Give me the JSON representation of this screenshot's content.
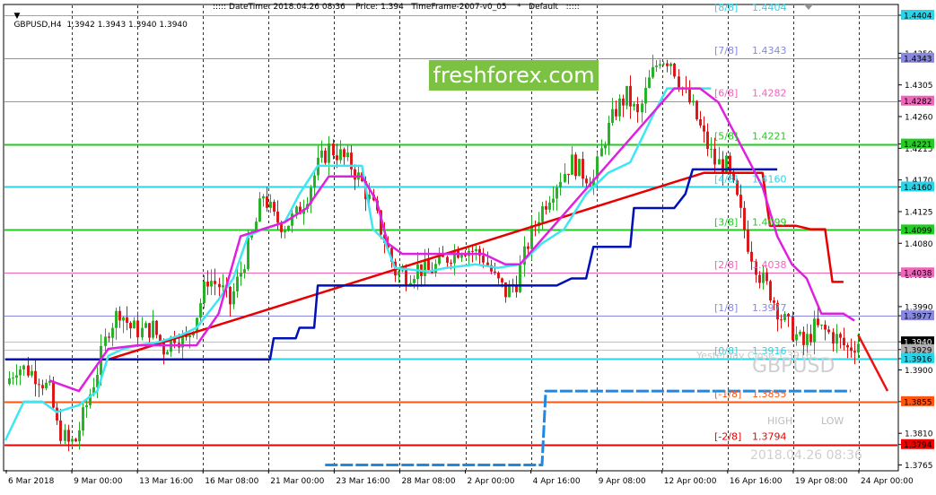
{
  "header": {
    "symbol_text": "GBPUSD,H4  1.3942 1.3943 1.3940 1.3940",
    "info_text": "::::: DateTime: 2018.04.26 08:36    Price: 1.394   TimeFrame-2007-v0_05    *   Default   :::::"
  },
  "brand": {
    "logo_text": "freshforex.com"
  },
  "watermark": {
    "symbol": "GBPUSD",
    "yesterday_text": "Yesterday Close 1.3916",
    "high_label": "HIGH",
    "low_label": "LOW",
    "datetime": "2018.04.26 08:36"
  },
  "colors": {
    "bull": "#22b022",
    "bear": "#dd1111",
    "cyan_line": "#3ee6f2",
    "magenta_line": "#e020e0",
    "blue_step": "#0010b8",
    "red_step": "#e80000",
    "dash_blue": "#1e88e5",
    "grid": "#000000"
  },
  "chart_data": {
    "type": "candlestick",
    "symbol": "GBPUSD",
    "timeframe": "H4",
    "ylim": [
      1.3758,
      1.4418
    ],
    "ohlc": [
      1.3942,
      1.3943,
      1.394,
      1.394
    ],
    "y_ticks": [
      "1.4404",
      "1.4350",
      "1.4343",
      "1.4305",
      "1.4282",
      "1.4260",
      "1.4221",
      "1.4215",
      "1.4170",
      "1.4160",
      "1.4125",
      "1.4099",
      "1.4080",
      "1.4038",
      "1.4035",
      "1.3990",
      "1.3977",
      "1.3940",
      "1.3929",
      "1.3916",
      "1.3900",
      "1.3855",
      "1.3810",
      "1.3794",
      "1.3765"
    ],
    "x_ticks": [
      "6 Mar 2018",
      "9 Mar 00:00",
      "13 Mar 16:00",
      "16 Mar 08:00",
      "21 Mar 00:00",
      "23 Mar 16:00",
      "28 Mar 08:00",
      "2 Apr 00:00",
      "4 Apr 16:00",
      "9 Apr 08:00",
      "12 Apr 00:00",
      "16 Apr 16:00",
      "19 Apr 08:00",
      "24 Apr 00:00"
    ],
    "price_tags": [
      {
        "label": "1.4404",
        "value": 1.4404,
        "color": "#2ad4e8"
      },
      {
        "label": "1.4343",
        "value": 1.4343,
        "color": "#8888e0"
      },
      {
        "label": "1.4282",
        "value": 1.4282,
        "color": "#ee66bb"
      },
      {
        "label": "1.4221",
        "value": 1.4221,
        "color": "#22cc22"
      },
      {
        "label": "1.4160",
        "value": 1.416,
        "color": "#2ad4e8"
      },
      {
        "label": "1.4099",
        "value": 1.4099,
        "color": "#22cc22"
      },
      {
        "label": "1.4038",
        "value": 1.4038,
        "color": "#ee66bb"
      },
      {
        "label": "1.3977",
        "value": 1.3977,
        "color": "#8888e0"
      },
      {
        "label": "1.3940",
        "value": 1.394,
        "color": "#000000"
      },
      {
        "label": "1.3929",
        "value": 1.3929,
        "color": "#b0b0b0"
      },
      {
        "label": "1.3916",
        "value": 1.3916,
        "color": "#2ad4e8"
      },
      {
        "label": "1.3855",
        "value": 1.3855,
        "color": "#ff5511"
      },
      {
        "label": "1.3794",
        "value": 1.3794,
        "color": "#ee0000"
      }
    ],
    "murrey_levels": [
      {
        "name": "[8/8]",
        "value": 1.4404,
        "value_label": "1.4404",
        "color": "#2ad4e8",
        "width": 1
      },
      {
        "name": "[7/8]",
        "value": 1.4343,
        "value_label": "1.4343",
        "color": "#8888e0",
        "width": 1
      },
      {
        "name": "[6/8]",
        "value": 1.4282,
        "value_label": "1.4282",
        "color": "#ee66bb",
        "width": 1
      },
      {
        "name": "[5/8]",
        "value": 1.4221,
        "value_label": "1.4221",
        "color": "#22cc22",
        "width": 2
      },
      {
        "name": "[4/8]",
        "value": 1.416,
        "value_label": "1.4160",
        "color": "#2ad4e8",
        "width": 2
      },
      {
        "name": "[3/8]",
        "value": 1.4099,
        "value_label": "1.4099",
        "color": "#22cc22",
        "width": 2
      },
      {
        "name": "[2/8]",
        "value": 1.4038,
        "value_label": "1.4038",
        "color": "#ee66bb",
        "width": 1
      },
      {
        "name": "[1/8]",
        "value": 1.3977,
        "value_label": "1.3977",
        "color": "#8888e0",
        "width": 1
      },
      {
        "name": "[0/8]",
        "value": 1.3916,
        "value_label": "1.3916",
        "color": "#2ad4e8",
        "width": 2
      },
      {
        "name": "[-1/8]",
        "value": 1.3855,
        "value_label": "1.3855",
        "color": "#ff5511",
        "width": 2
      },
      {
        "name": "[-2/8]",
        "value": 1.3794,
        "value_label": "1.3794",
        "color": "#ee0000",
        "width": 2
      }
    ],
    "price_path": [
      [
        0,
        1.388
      ],
      [
        3,
        1.3905
      ],
      [
        6,
        1.39
      ],
      [
        9,
        1.389
      ],
      [
        12,
        1.387
      ],
      [
        14,
        1.382
      ],
      [
        17,
        1.3795
      ],
      [
        19,
        1.38
      ],
      [
        22,
        1.385
      ],
      [
        25,
        1.39
      ],
      [
        28,
        1.396
      ],
      [
        31,
        1.3985
      ],
      [
        34,
        1.396
      ],
      [
        37,
        1.3955
      ],
      [
        40,
        1.396
      ],
      [
        43,
        1.393
      ],
      [
        46,
        1.395
      ],
      [
        49,
        1.394
      ],
      [
        52,
        1.398
      ],
      [
        55,
        1.403
      ],
      [
        58,
        1.402
      ],
      [
        61,
        1.3995
      ],
      [
        64,
        1.404
      ],
      [
        67,
        1.409
      ],
      [
        70,
        1.415
      ],
      [
        73,
        1.4115
      ],
      [
        76,
        1.4105
      ],
      [
        79,
        1.412
      ],
      [
        82,
        1.415
      ],
      [
        85,
        1.419
      ],
      [
        88,
        1.4215
      ],
      [
        91,
        1.4205
      ],
      [
        94,
        1.419
      ],
      [
        97,
        1.4165
      ],
      [
        100,
        1.413
      ],
      [
        103,
        1.4085
      ],
      [
        106,
        1.404
      ],
      [
        109,
        1.4035
      ],
      [
        112,
        1.4045
      ],
      [
        115,
        1.404
      ],
      [
        118,
        1.405
      ],
      [
        121,
        1.4065
      ],
      [
        124,
        1.4075
      ],
      [
        127,
        1.407
      ],
      [
        130,
        1.406
      ],
      [
        133,
        1.403
      ],
      [
        136,
        1.401
      ],
      [
        139,
        1.4025
      ],
      [
        142,
        1.408
      ],
      [
        145,
        1.412
      ],
      [
        148,
        1.415
      ],
      [
        151,
        1.4175
      ],
      [
        154,
        1.4195
      ],
      [
        157,
        1.418
      ],
      [
        160,
        1.417
      ],
      [
        163,
        1.423
      ],
      [
        166,
        1.427
      ],
      [
        169,
        1.429
      ],
      [
        172,
        1.426
      ],
      [
        175,
        1.431
      ],
      [
        178,
        1.4345
      ],
      [
        181,
        1.434
      ],
      [
        184,
        1.43
      ],
      [
        187,
        1.427
      ],
      [
        190,
        1.423
      ],
      [
        193,
        1.4195
      ],
      [
        196,
        1.419
      ],
      [
        199,
        1.414
      ],
      [
        202,
        1.408
      ],
      [
        205,
        1.4035
      ],
      [
        208,
        1.401
      ],
      [
        211,
        1.3975
      ],
      [
        214,
        1.3955
      ],
      [
        217,
        1.3935
      ],
      [
        220,
        1.396
      ],
      [
        223,
        1.3955
      ],
      [
        226,
        1.3945
      ],
      [
        229,
        1.393
      ],
      [
        232,
        1.394
      ]
    ],
    "cyan_line": [
      [
        0,
        1.38
      ],
      [
        5,
        1.3855
      ],
      [
        10,
        1.3855
      ],
      [
        14,
        1.384
      ],
      [
        20,
        1.385
      ],
      [
        25,
        1.387
      ],
      [
        28,
        1.392
      ],
      [
        32,
        1.393
      ],
      [
        36,
        1.3935
      ],
      [
        42,
        1.394
      ],
      [
        48,
        1.395
      ],
      [
        52,
        1.396
      ],
      [
        58,
        1.4
      ],
      [
        62,
        1.403
      ],
      [
        66,
        1.409
      ],
      [
        70,
        1.41
      ],
      [
        76,
        1.411
      ],
      [
        80,
        1.415
      ],
      [
        85,
        1.419
      ],
      [
        97,
        1.419
      ],
      [
        100,
        1.41
      ],
      [
        103,
        1.4085
      ],
      [
        106,
        1.4045
      ],
      [
        115,
        1.404
      ],
      [
        120,
        1.4045
      ],
      [
        128,
        1.405
      ],
      [
        134,
        1.4045
      ],
      [
        140,
        1.405
      ],
      [
        146,
        1.408
      ],
      [
        152,
        1.41
      ],
      [
        158,
        1.415
      ],
      [
        164,
        1.418
      ],
      [
        170,
        1.4195
      ],
      [
        176,
        1.426
      ],
      [
        180,
        1.43
      ],
      [
        192,
        1.43
      ]
    ],
    "magenta_line": [
      [
        12,
        1.3885
      ],
      [
        20,
        1.387
      ],
      [
        28,
        1.393
      ],
      [
        36,
        1.3935
      ],
      [
        44,
        1.3935
      ],
      [
        52,
        1.3935
      ],
      [
        58,
        1.398
      ],
      [
        64,
        1.409
      ],
      [
        70,
        1.41
      ],
      [
        76,
        1.411
      ],
      [
        82,
        1.413
      ],
      [
        88,
        1.4175
      ],
      [
        97,
        1.4175
      ],
      [
        101,
        1.414
      ],
      [
        104,
        1.408
      ],
      [
        108,
        1.4065
      ],
      [
        114,
        1.4065
      ],
      [
        120,
        1.4065
      ],
      [
        130,
        1.4065
      ],
      [
        136,
        1.405
      ],
      [
        140,
        1.405
      ],
      [
        182,
        1.43
      ],
      [
        189,
        1.43
      ],
      [
        194,
        1.428
      ],
      [
        198,
        1.424
      ],
      [
        202,
        1.42
      ],
      [
        206,
        1.416
      ],
      [
        210,
        1.409
      ],
      [
        214,
        1.405
      ],
      [
        218,
        1.403
      ],
      [
        222,
        1.398
      ],
      [
        228,
        1.398
      ],
      [
        231,
        1.397
      ]
    ],
    "blue_step": [
      [
        0,
        1.3915
      ],
      [
        72,
        1.3915
      ],
      [
        73,
        1.3945
      ],
      [
        79,
        1.3945
      ],
      [
        80,
        1.396
      ],
      [
        84,
        1.396
      ],
      [
        85,
        1.402
      ],
      [
        150,
        1.402
      ],
      [
        154,
        1.403
      ],
      [
        158,
        1.403
      ],
      [
        160,
        1.4075
      ],
      [
        170,
        1.4075
      ],
      [
        171,
        1.413
      ],
      [
        182,
        1.413
      ],
      [
        185,
        1.415
      ],
      [
        187,
        1.4185
      ],
      [
        210,
        1.4185
      ]
    ],
    "red_step": [
      [
        0,
        1.3915
      ],
      [
        28,
        1.3915
      ],
      [
        190,
        1.418
      ],
      [
        202,
        1.418
      ],
      [
        206,
        1.418
      ],
      [
        208,
        1.4105
      ],
      [
        215,
        1.4105
      ],
      [
        219,
        1.41
      ],
      [
        223,
        1.41
      ],
      [
        225,
        1.4025
      ],
      [
        228,
        1.4025
      ]
    ],
    "dashed_projection": [
      [
        87,
        1.3765
      ],
      [
        146,
        1.3765
      ],
      [
        147,
        1.387
      ],
      [
        230,
        1.387
      ]
    ],
    "forecast_line": [
      [
        232,
        1.395
      ],
      [
        240,
        1.387
      ]
    ]
  }
}
